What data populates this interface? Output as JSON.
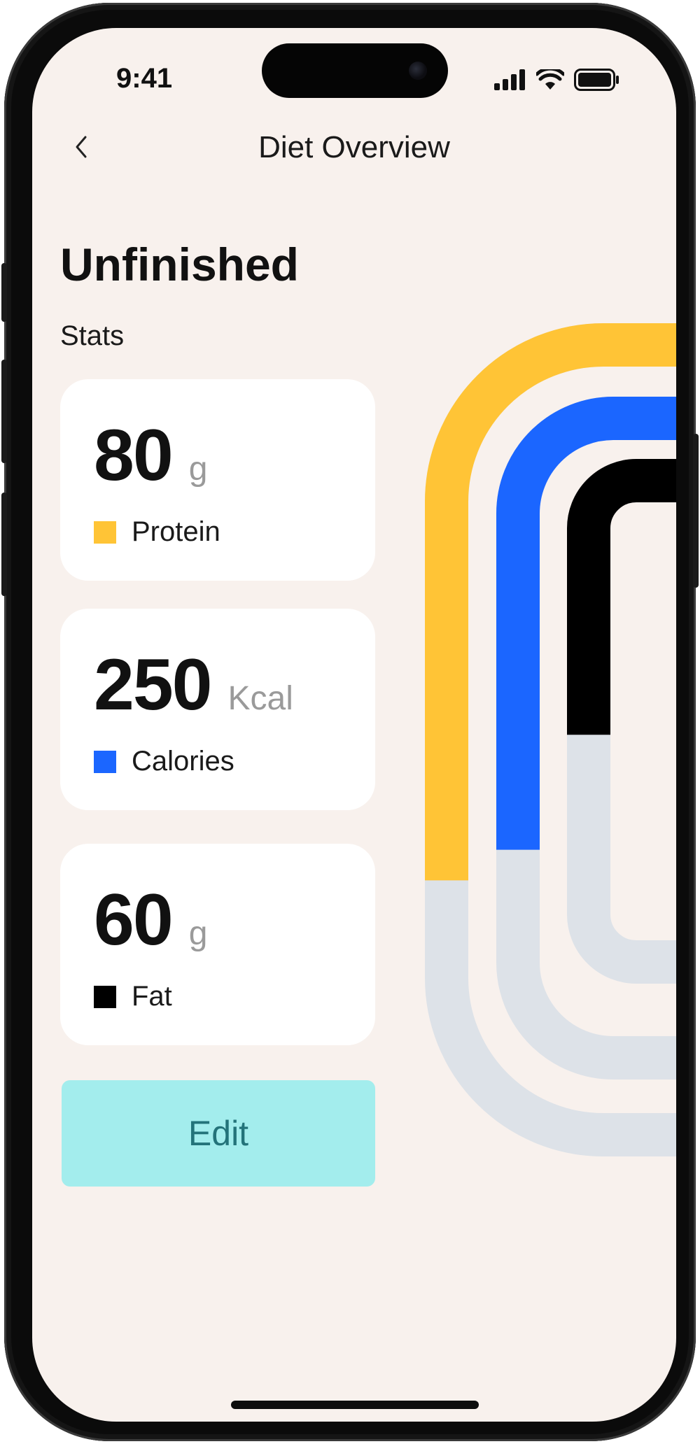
{
  "status_bar": {
    "time": "9:41",
    "icons": [
      "signal-icon",
      "wifi-icon",
      "battery-icon"
    ]
  },
  "nav": {
    "back_icon": "chevron-left-icon",
    "title": "Diet Overview"
  },
  "heading": "Unfinished",
  "subheading": "Stats",
  "stats": [
    {
      "value": "80",
      "unit": "g",
      "label": "Protein",
      "color": "#ffc436"
    },
    {
      "value": "250",
      "unit": "Kcal",
      "label": "Calories",
      "color": "#1b66ff"
    },
    {
      "value": "60",
      "unit": "g",
      "label": "Fat",
      "color": "#000000"
    }
  ],
  "edit_button": {
    "label": "Edit",
    "color": "#a3eded",
    "text_color": "#23737a"
  },
  "progress_arcs": {
    "track_color": "#dde2e8",
    "items": [
      {
        "name": "Protein",
        "color": "#ffc436",
        "fraction": 0.62
      },
      {
        "name": "Calories",
        "color": "#1b66ff",
        "fraction": 0.62
      },
      {
        "name": "Fat",
        "color": "#000000",
        "fraction": 0.52
      }
    ]
  },
  "colors": {
    "background": "#f8f1ed",
    "card": "#ffffff"
  }
}
